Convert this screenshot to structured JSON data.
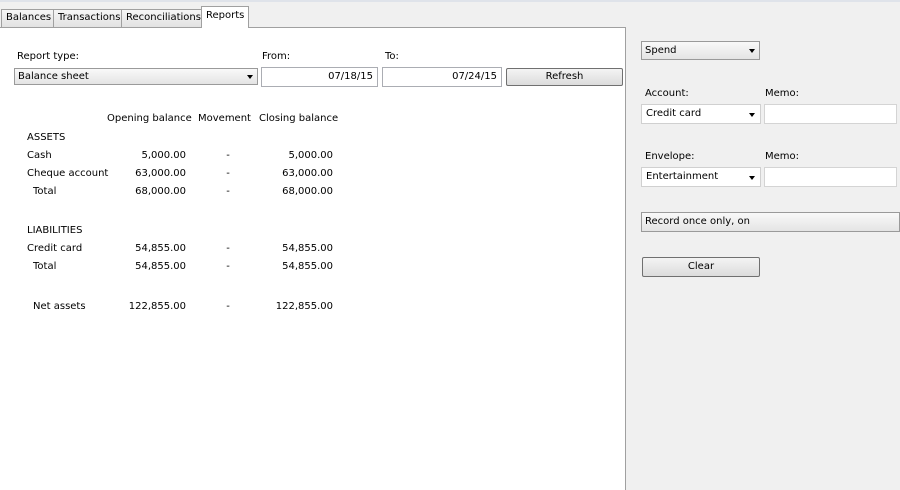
{
  "tabs": [
    {
      "label": "Balances"
    },
    {
      "label": "Transactions"
    },
    {
      "label": "Reconciliations"
    },
    {
      "label": "Reports",
      "active": true
    }
  ],
  "report": {
    "report_type_label": "Report type:",
    "report_type_value": "Balance sheet",
    "from_label": "From:",
    "from_value": "07/18/15",
    "to_label": "To:",
    "to_value": "07/24/15",
    "refresh_label": "Refresh",
    "columns": [
      "Opening balance",
      "Movement",
      "Closing balance"
    ],
    "assets": {
      "heading": "ASSETS",
      "rows": [
        {
          "name": "Cash",
          "opening": "5,000.00",
          "movement": "-",
          "closing": "5,000.00"
        },
        {
          "name": "Cheque account",
          "opening": "63,000.00",
          "movement": "-",
          "closing": "63,000.00"
        }
      ],
      "total": {
        "name": "Total",
        "opening": "68,000.00",
        "movement": "-",
        "closing": "68,000.00"
      }
    },
    "liabilities": {
      "heading": "LIABILITIES",
      "rows": [
        {
          "name": "Credit card",
          "opening": "54,855.00",
          "movement": "-",
          "closing": "54,855.00"
        }
      ],
      "total": {
        "name": "Total",
        "opening": "54,855.00",
        "movement": "-",
        "closing": "54,855.00"
      }
    },
    "net": {
      "name": "Net assets",
      "opening": "122,855.00",
      "movement": "-",
      "closing": "122,855.00"
    }
  },
  "side": {
    "type_value": "Spend",
    "account_label": "Account:",
    "account_value": "Credit card",
    "memo1_label": "Memo:",
    "memo1_value": "",
    "envelope_label": "Envelope:",
    "envelope_value": "Entertainment",
    "memo2_label": "Memo:",
    "memo2_value": "",
    "recurrence_value": "Record once only, on",
    "clear_label": "Clear"
  }
}
